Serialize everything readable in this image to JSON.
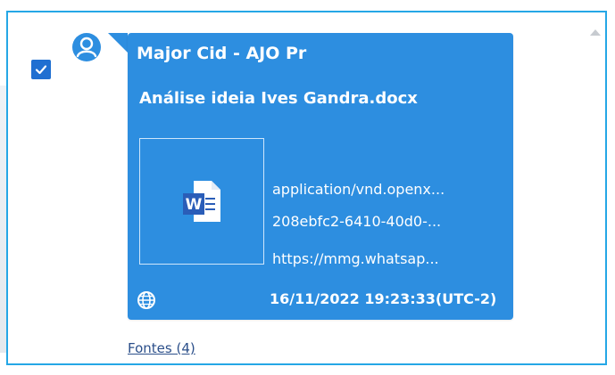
{
  "message": {
    "checked": true,
    "sender": "Major Cid - AJO Pr",
    "attachment_name": "Análise ideia Ives Gandra.docx",
    "attachment_icon": "word-document-icon",
    "meta_lines": [
      "application/vnd.openx...",
      "208ebfc2-6410-40d0-...",
      "https://mmg.whatsap..."
    ],
    "timestamp": "16/11/2022 19:23:33(UTC-2)",
    "sources_link": "Fontes (4)"
  },
  "colors": {
    "bubble": "#2d8ee0",
    "frame_border": "#25a7e6",
    "checkbox": "#1f6fd1",
    "avatar": "#2d8ee0",
    "link": "#2b4f8a",
    "word_blue": "#2a5db8"
  }
}
